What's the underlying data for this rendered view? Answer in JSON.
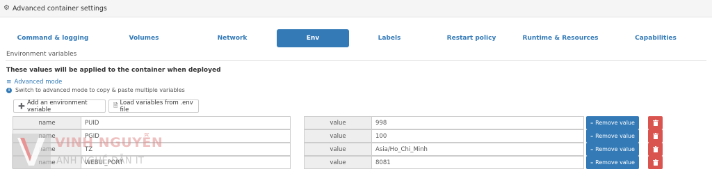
{
  "header": {
    "title": "Advanced container settings",
    "icon": "gear-icon"
  },
  "tabs": [
    {
      "label": "Command & logging",
      "active": false
    },
    {
      "label": "Volumes",
      "active": false
    },
    {
      "label": "Network",
      "active": false
    },
    {
      "label": "Env",
      "active": true
    },
    {
      "label": "Labels",
      "active": false
    },
    {
      "label": "Restart policy",
      "active": false
    },
    {
      "label": "Runtime & Resources",
      "active": false
    },
    {
      "label": "Capabilities",
      "active": false
    }
  ],
  "env": {
    "section_title": "Environment variables",
    "applied_text": "These values will be applied to the container when deployed",
    "advanced_mode_label": "Advanced mode",
    "advanced_help": "Switch to advanced mode to copy & paste multiple variables",
    "add_button": "Add an environment variable",
    "load_button": "Load variables from .env file",
    "name_label": "name",
    "value_label": "value",
    "remove_button": "Remove value",
    "variables": [
      {
        "name": "PUID",
        "value": "998"
      },
      {
        "name": "PGID",
        "value": "100"
      },
      {
        "name": "TZ",
        "value": "Asia/Ho_Chi_Minh"
      },
      {
        "name": "WEBUI_PORT",
        "value": "8081"
      }
    ]
  },
  "watermark": {
    "name": "VINH NGUYỄN",
    "sub": "ANH NGHỀ DẪN IT"
  },
  "colors": {
    "primary": "#337ab7",
    "danger": "#d9534f",
    "label_bg": "#eeeeee",
    "border": "#cccccc"
  }
}
